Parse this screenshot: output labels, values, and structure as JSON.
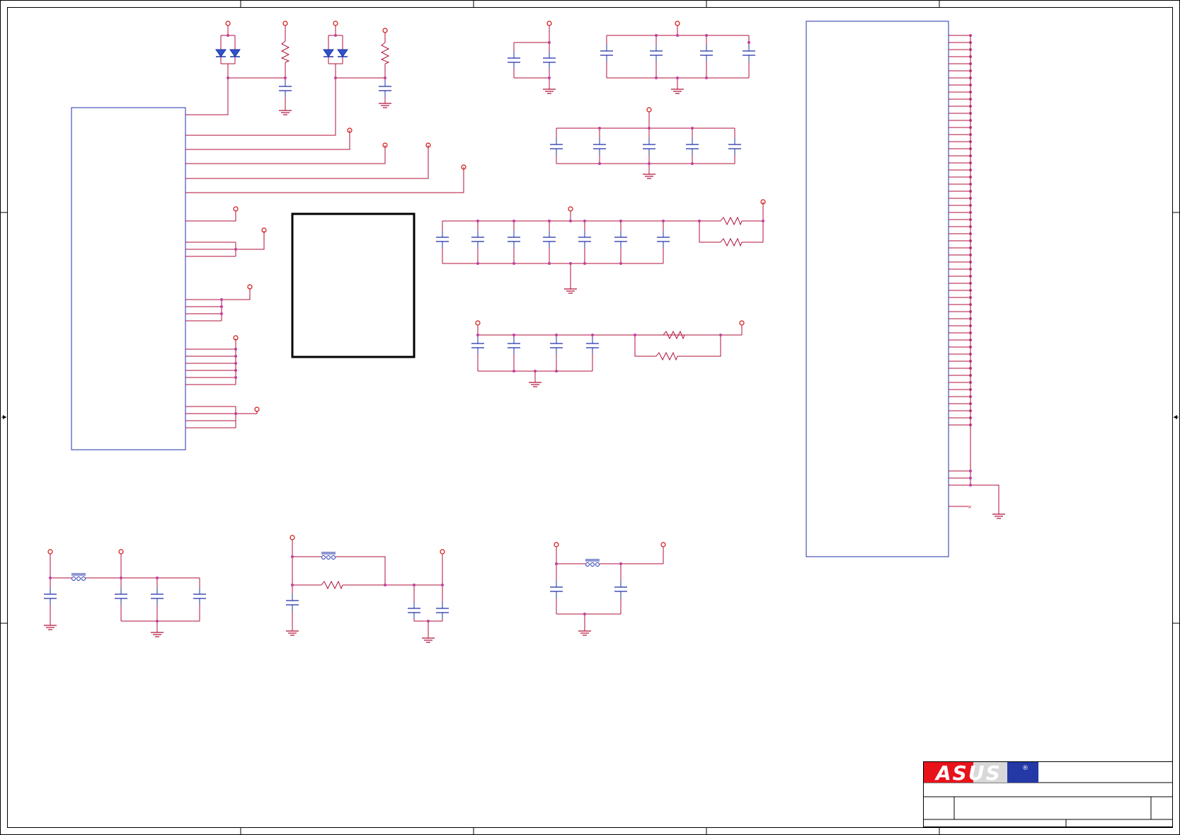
{
  "title_block": {
    "logo_text": "ASUS",
    "registered_mark": "®"
  },
  "colors": {
    "border": "#000000",
    "wire": "#b0103a",
    "component": "#1f2fa8",
    "junction": "#c040a0",
    "power": "#d01010",
    "logo_red": "#e8121b",
    "logo_blue": "#2438a6"
  }
}
